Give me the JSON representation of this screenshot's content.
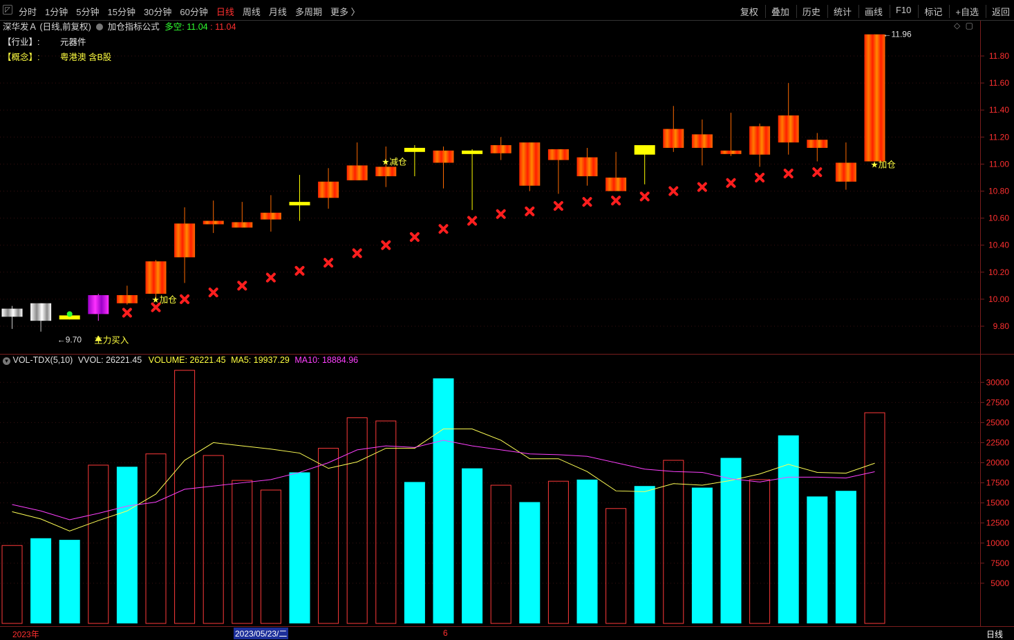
{
  "toolbar": {
    "pin_icon": "◸",
    "periods": [
      "分时",
      "1分钟",
      "5分钟",
      "15分钟",
      "30分钟",
      "60分钟",
      "日线",
      "周线",
      "月线",
      "多周期",
      "更多 〉"
    ],
    "active_period": "日线",
    "right_tools": [
      "复权",
      "叠加",
      "历史",
      "统计",
      "画线",
      "F10",
      "标记",
      "+自选",
      "返回"
    ]
  },
  "header": {
    "stock_name": "深华发Ａ",
    "mode": "(日线,前复权)",
    "formula_name": "加仓指标公式",
    "duokong_label": "多空:",
    "duokong_value1": "11.04",
    "duokong_sep": ":",
    "duokong_value2": "11.04",
    "diamond_icon": "◇",
    "square_icon": "▢"
  },
  "industry": {
    "label": "【行业】:",
    "value": "元器件"
  },
  "concept": {
    "label": "【概念】:",
    "value": "粤港澳 含B股"
  },
  "volume_header": {
    "circle_icon": "▾",
    "name": "VOL-TDX(5,10)",
    "vvol": "VVOL: 26221.45",
    "volume": "VOLUME: 26221.45",
    "ma5": "MA5: 19937.29",
    "ma10": "MA10: 18884.96"
  },
  "bottom_bar": {
    "year_label": "2023年",
    "date_label": "2023/05/23/二",
    "month_label": "6",
    "period_label": "日线"
  },
  "colors": {
    "up_red": "#ff2a2a",
    "candle_orange": "#ff6a00",
    "doji_yellow": "#ffff00",
    "cross_red": "#ff1e1e",
    "volume_cyan": "#00ffff",
    "volume_outline": "#ff3a3a",
    "ma5": "#ffff55",
    "ma10": "#ff40ff",
    "axis": "#7a1d1d",
    "text_yellow": "#ffff40",
    "text_red": "#ff3030",
    "text_green": "#30ff30"
  },
  "chart_data": [
    {
      "type": "candlestick",
      "ylim": [
        9.7,
        12.0
      ],
      "y_ticks": [
        "9.80",
        "10.00",
        "10.20",
        "10.40",
        "10.60",
        "10.80",
        "11.00",
        "11.20",
        "11.40",
        "11.60",
        "11.80"
      ],
      "candles": [
        {
          "o": 9.93,
          "c": 9.87,
          "h": 9.95,
          "l": 9.78,
          "style": "white"
        },
        {
          "o": 9.84,
          "c": 9.97,
          "h": 9.97,
          "l": 9.76,
          "style": "white"
        },
        {
          "o": 9.85,
          "c": 9.88,
          "h": 9.89,
          "l": 9.85,
          "style": "yellow",
          "mark": "green_ball"
        },
        {
          "o": 9.89,
          "c": 10.03,
          "h": 10.04,
          "l": 9.84,
          "style": "magenta"
        },
        {
          "o": 9.97,
          "c": 10.03,
          "h": 10.1,
          "l": 9.96,
          "style": "up"
        },
        {
          "o": 10.04,
          "c": 10.28,
          "h": 10.29,
          "l": 10.0,
          "style": "up"
        },
        {
          "o": 10.31,
          "c": 10.56,
          "h": 10.68,
          "l": 10.12,
          "style": "up"
        },
        {
          "o": 10.56,
          "c": 10.58,
          "h": 10.73,
          "l": 10.49,
          "style": "up"
        },
        {
          "o": 10.53,
          "c": 10.57,
          "h": 10.72,
          "l": 10.53,
          "style": "up"
        },
        {
          "o": 10.59,
          "c": 10.64,
          "h": 10.77,
          "l": 10.5,
          "style": "up"
        },
        {
          "o": 10.71,
          "c": 10.72,
          "h": 10.92,
          "l": 10.58,
          "style": "yellow"
        },
        {
          "o": 10.75,
          "c": 10.87,
          "h": 10.97,
          "l": 10.67,
          "style": "up"
        },
        {
          "o": 10.88,
          "c": 10.99,
          "h": 11.16,
          "l": 10.88,
          "style": "up"
        },
        {
          "o": 10.91,
          "c": 10.98,
          "h": 11.13,
          "l": 10.83,
          "style": "up"
        },
        {
          "o": 11.09,
          "c": 11.12,
          "h": 11.14,
          "l": 10.91,
          "style": "yellow"
        },
        {
          "o": 11.01,
          "c": 11.1,
          "h": 11.13,
          "l": 10.82,
          "style": "up"
        },
        {
          "o": 11.08,
          "c": 11.1,
          "h": 11.11,
          "l": 10.66,
          "style": "yellow"
        },
        {
          "o": 11.08,
          "c": 11.14,
          "h": 11.2,
          "l": 11.03,
          "style": "up"
        },
        {
          "o": 10.84,
          "c": 11.16,
          "h": 11.16,
          "l": 10.8,
          "style": "up"
        },
        {
          "o": 11.03,
          "c": 11.11,
          "h": 11.11,
          "l": 10.78,
          "style": "up"
        },
        {
          "o": 10.91,
          "c": 11.05,
          "h": 11.12,
          "l": 10.84,
          "style": "up"
        },
        {
          "o": 10.8,
          "c": 10.9,
          "h": 11.09,
          "l": 10.8,
          "style": "up"
        },
        {
          "o": 11.07,
          "c": 11.14,
          "h": 11.14,
          "l": 10.85,
          "style": "yellow"
        },
        {
          "o": 11.12,
          "c": 11.26,
          "h": 11.43,
          "l": 11.09,
          "style": "up"
        },
        {
          "o": 11.12,
          "c": 11.22,
          "h": 11.33,
          "l": 10.99,
          "style": "up"
        },
        {
          "o": 11.08,
          "c": 11.1,
          "h": 11.38,
          "l": 11.06,
          "style": "up"
        },
        {
          "o": 11.07,
          "c": 11.28,
          "h": 11.3,
          "l": 10.98,
          "style": "up"
        },
        {
          "o": 11.16,
          "c": 11.36,
          "h": 11.6,
          "l": 11.07,
          "style": "up"
        },
        {
          "o": 11.12,
          "c": 11.18,
          "h": 11.23,
          "l": 11.02,
          "style": "up"
        },
        {
          "o": 10.87,
          "c": 11.01,
          "h": 11.16,
          "l": 10.81,
          "style": "up"
        },
        {
          "o": 11.02,
          "c": 11.96,
          "h": 11.96,
          "l": 11.02,
          "style": "up"
        }
      ],
      "cross_markers": [
        null,
        null,
        null,
        null,
        9.9,
        9.94,
        10.0,
        10.05,
        10.1,
        10.16,
        10.21,
        10.27,
        10.34,
        10.4,
        10.46,
        10.52,
        10.58,
        10.63,
        10.65,
        10.69,
        10.72,
        10.73,
        10.76,
        10.8,
        10.83,
        10.86,
        10.9,
        10.93,
        10.94,
        null,
        null
      ],
      "annotations": [
        {
          "index": 5,
          "text": "★加仓",
          "price": 10.0
        },
        {
          "index": 13,
          "text": "★减仓",
          "price": 11.02
        },
        {
          "index": 30,
          "text": "★加仓",
          "price": 11.0
        },
        {
          "index": 3,
          "text": "主力买入",
          "price": 9.7
        }
      ],
      "low_label": {
        "index": 2,
        "text": "9.70"
      },
      "high_label": {
        "index": 30,
        "text": "11.96"
      }
    },
    {
      "type": "bar",
      "ylim": [
        0,
        32000
      ],
      "y_ticks": [
        "5000",
        "7500",
        "10000",
        "12500",
        "15000",
        "17500",
        "20000",
        "22500",
        "25000",
        "27500",
        "30000"
      ],
      "values": [
        9700,
        10600,
        10400,
        19700,
        19500,
        21100,
        31500,
        20900,
        17800,
        16600,
        18800,
        21800,
        25600,
        25200,
        17600,
        30500,
        19300,
        17200,
        15100,
        17700,
        17900,
        14300,
        17100,
        20300,
        16900,
        20600,
        17900,
        23400,
        15800,
        16500,
        26221
      ],
      "filled": [
        false,
        true,
        true,
        false,
        true,
        false,
        false,
        false,
        false,
        false,
        true,
        false,
        false,
        false,
        true,
        true,
        true,
        false,
        true,
        false,
        true,
        false,
        true,
        false,
        true,
        true,
        false,
        true,
        true,
        true,
        false
      ],
      "ma5": [
        13900,
        13000,
        11500,
        12800,
        14000,
        16100,
        20300,
        22500,
        22100,
        21700,
        21200,
        19300,
        20100,
        21800,
        21800,
        24200,
        24200,
        22800,
        20500,
        20500,
        18900,
        16500,
        16400,
        17400,
        17200,
        17800,
        18600,
        19800,
        18800,
        18700,
        19937
      ],
      "ma10": [
        14800,
        14000,
        12900,
        13700,
        14600,
        15100,
        16700,
        17100,
        17500,
        17900,
        18800,
        20000,
        21600,
        22100,
        21900,
        22800,
        22100,
        21600,
        21100,
        21000,
        20800,
        20000,
        19200,
        18900,
        18800,
        18000,
        17600,
        18200,
        18200,
        18100,
        18885
      ]
    }
  ]
}
